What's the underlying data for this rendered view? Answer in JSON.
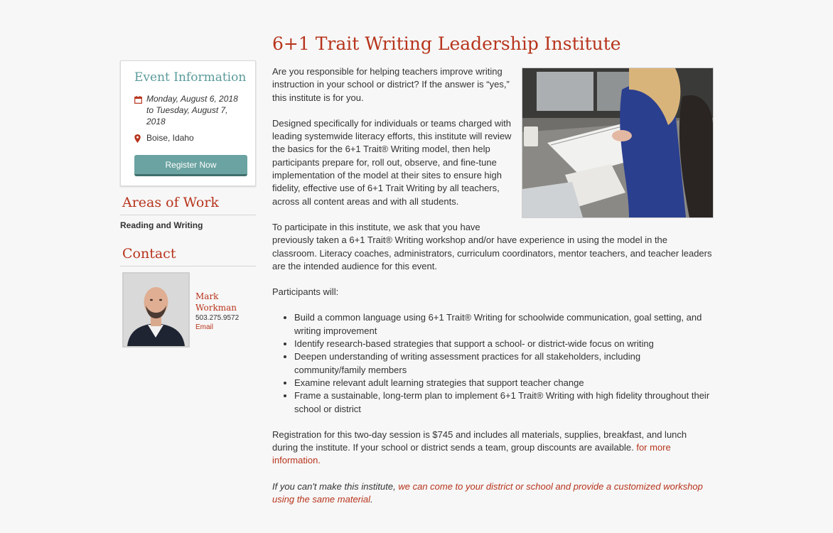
{
  "event": {
    "title": "Event Information",
    "date_line1": "Monday, August 6, 2018",
    "date_line2": "to Tuesday, August 7,",
    "date_line3": "2018",
    "location": "Boise, Idaho",
    "register_label": "Register Now"
  },
  "areas": {
    "heading": "Areas of Work",
    "items": [
      "Reading and Writing"
    ]
  },
  "contact": {
    "heading": "Contact",
    "name_line1": "Mark",
    "name_line2": "Workman",
    "phone": "503.275.9572",
    "email_label": "Email"
  },
  "main": {
    "title": "6+1 Trait Writing Leadership Institute",
    "p1": "Are you responsible for helping teachers improve writing instruction in your school or district? If the answer is “yes,” this institute is for you.",
    "p2": "Designed specifically for individuals or teams charged with leading systemwide literacy efforts, this institute will review the basics for the 6+1 Trait® Writing model, then help participants prepare for, roll out, observe, and fine-tune implementation of the model at their sites to ensure high fidelity, effective use of 6+1 Trait Writing by all teachers, across all content areas and with all students.",
    "p3a": "To participate in this institute, we ask that you have",
    "p3b": "previously taken a 6+1 Trait® Writing workshop and/or have experience in using the model in the classroom. Literacy coaches, administrators, curriculum coordinators, mentor teachers, and teacher leaders are the intended audience for this event.",
    "participants_intro": "Participants will:",
    "bullets": [
      "Build a common language using 6+1 Trait® Writing for schoolwide communication, goal setting, and writing improvement",
      "Identify research-based strategies that support a school- or district-wide focus on writing",
      "Deepen understanding of writing assessment practices for all stakeholders, including community/family members",
      "Examine relevant adult learning strategies that support teacher change",
      "Frame a sustainable, long-term plan to implement 6+1 Trait® Writing with high fidelity throughout their school or district"
    ],
    "registration_text": "Registration for this two-day session is $745 and includes all materials, supplies, breakfast, and lunch during the institute. If your school or district sends a team, group discounts are available.",
    "registration_link": "for more information.",
    "cant_make_text": "If you can't make this institute,",
    "cant_make_link": "we can come to your district or school and provide a customized workshop using the same material",
    "cant_make_end": "."
  },
  "colors": {
    "accent_red": "#b7341c",
    "teal": "#5b9a9a",
    "button_teal": "#6aa3a1"
  }
}
